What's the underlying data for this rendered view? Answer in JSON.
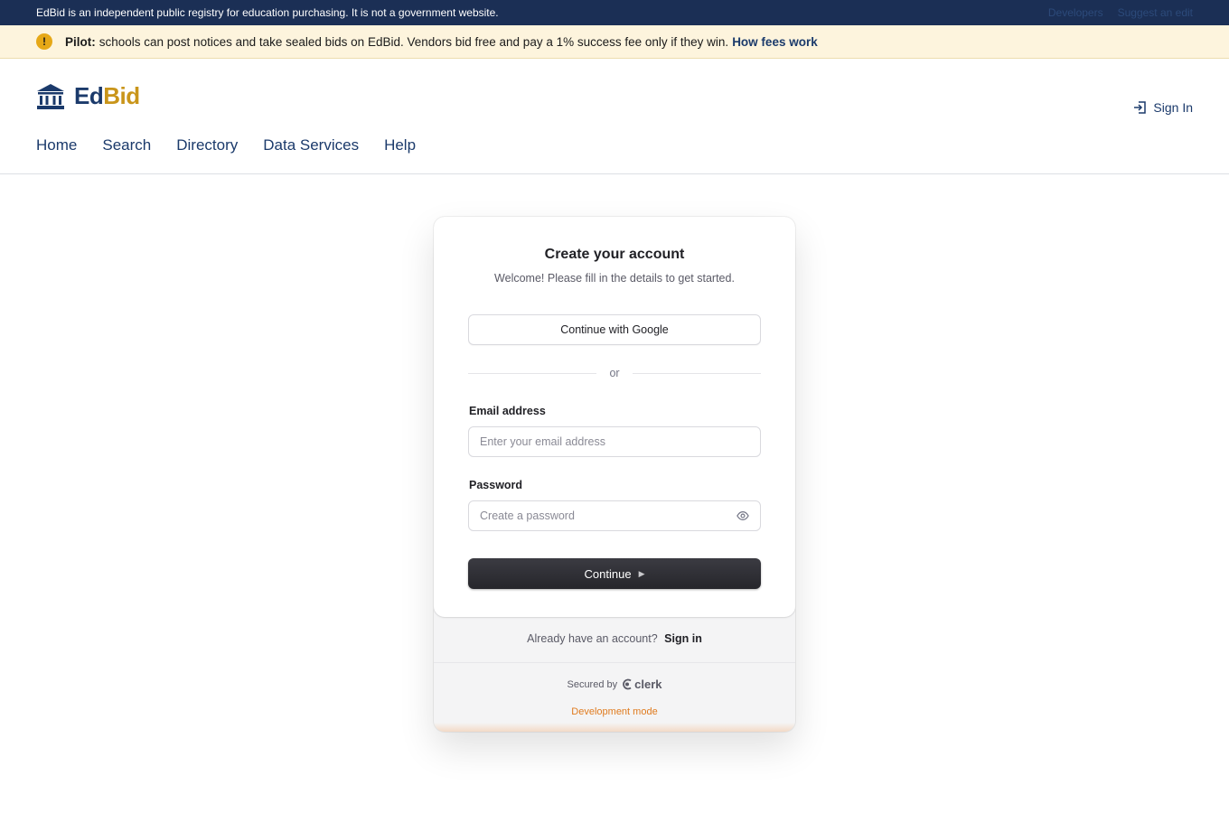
{
  "topbar": {
    "notice": "EdBid is an independent public registry for education purchasing. It is not a government website.",
    "links": [
      "Developers",
      "Suggest an edit"
    ]
  },
  "pilot": {
    "label": "Pilot:",
    "text": "schools can post notices and take sealed bids on EdBid. Vendors bid free and pay a 1% success fee only if they win.",
    "link": "How fees work"
  },
  "header": {
    "logo_ed": "Ed",
    "logo_bid": "Bid",
    "sign_in": "Sign In",
    "nav": [
      "Home",
      "Search",
      "Directory",
      "Data Services",
      "Help"
    ]
  },
  "auth": {
    "title": "Create your account",
    "subtitle": "Welcome! Please fill in the details to get started.",
    "google_button": "Continue with Google",
    "divider": "or",
    "email_label": "Email address",
    "email_placeholder": "Enter your email address",
    "password_label": "Password",
    "password_placeholder": "Create a password",
    "continue_button": "Continue",
    "already_text": "Already have an account?",
    "sign_in_link": "Sign in",
    "secured_by": "Secured by",
    "clerk": "clerk",
    "dev_mode": "Development mode"
  },
  "colors": {
    "navy": "#1b2f55",
    "brand_blue": "#1b3a6b",
    "brand_gold": "#c9951a",
    "pilot_bg": "#fdf4dd",
    "dev_orange": "#e07b1f"
  },
  "icons": [
    "warning-icon",
    "bank-icon",
    "sign-in-icon",
    "eye-icon",
    "arrow-right-icon",
    "clerk-logo-icon"
  ]
}
